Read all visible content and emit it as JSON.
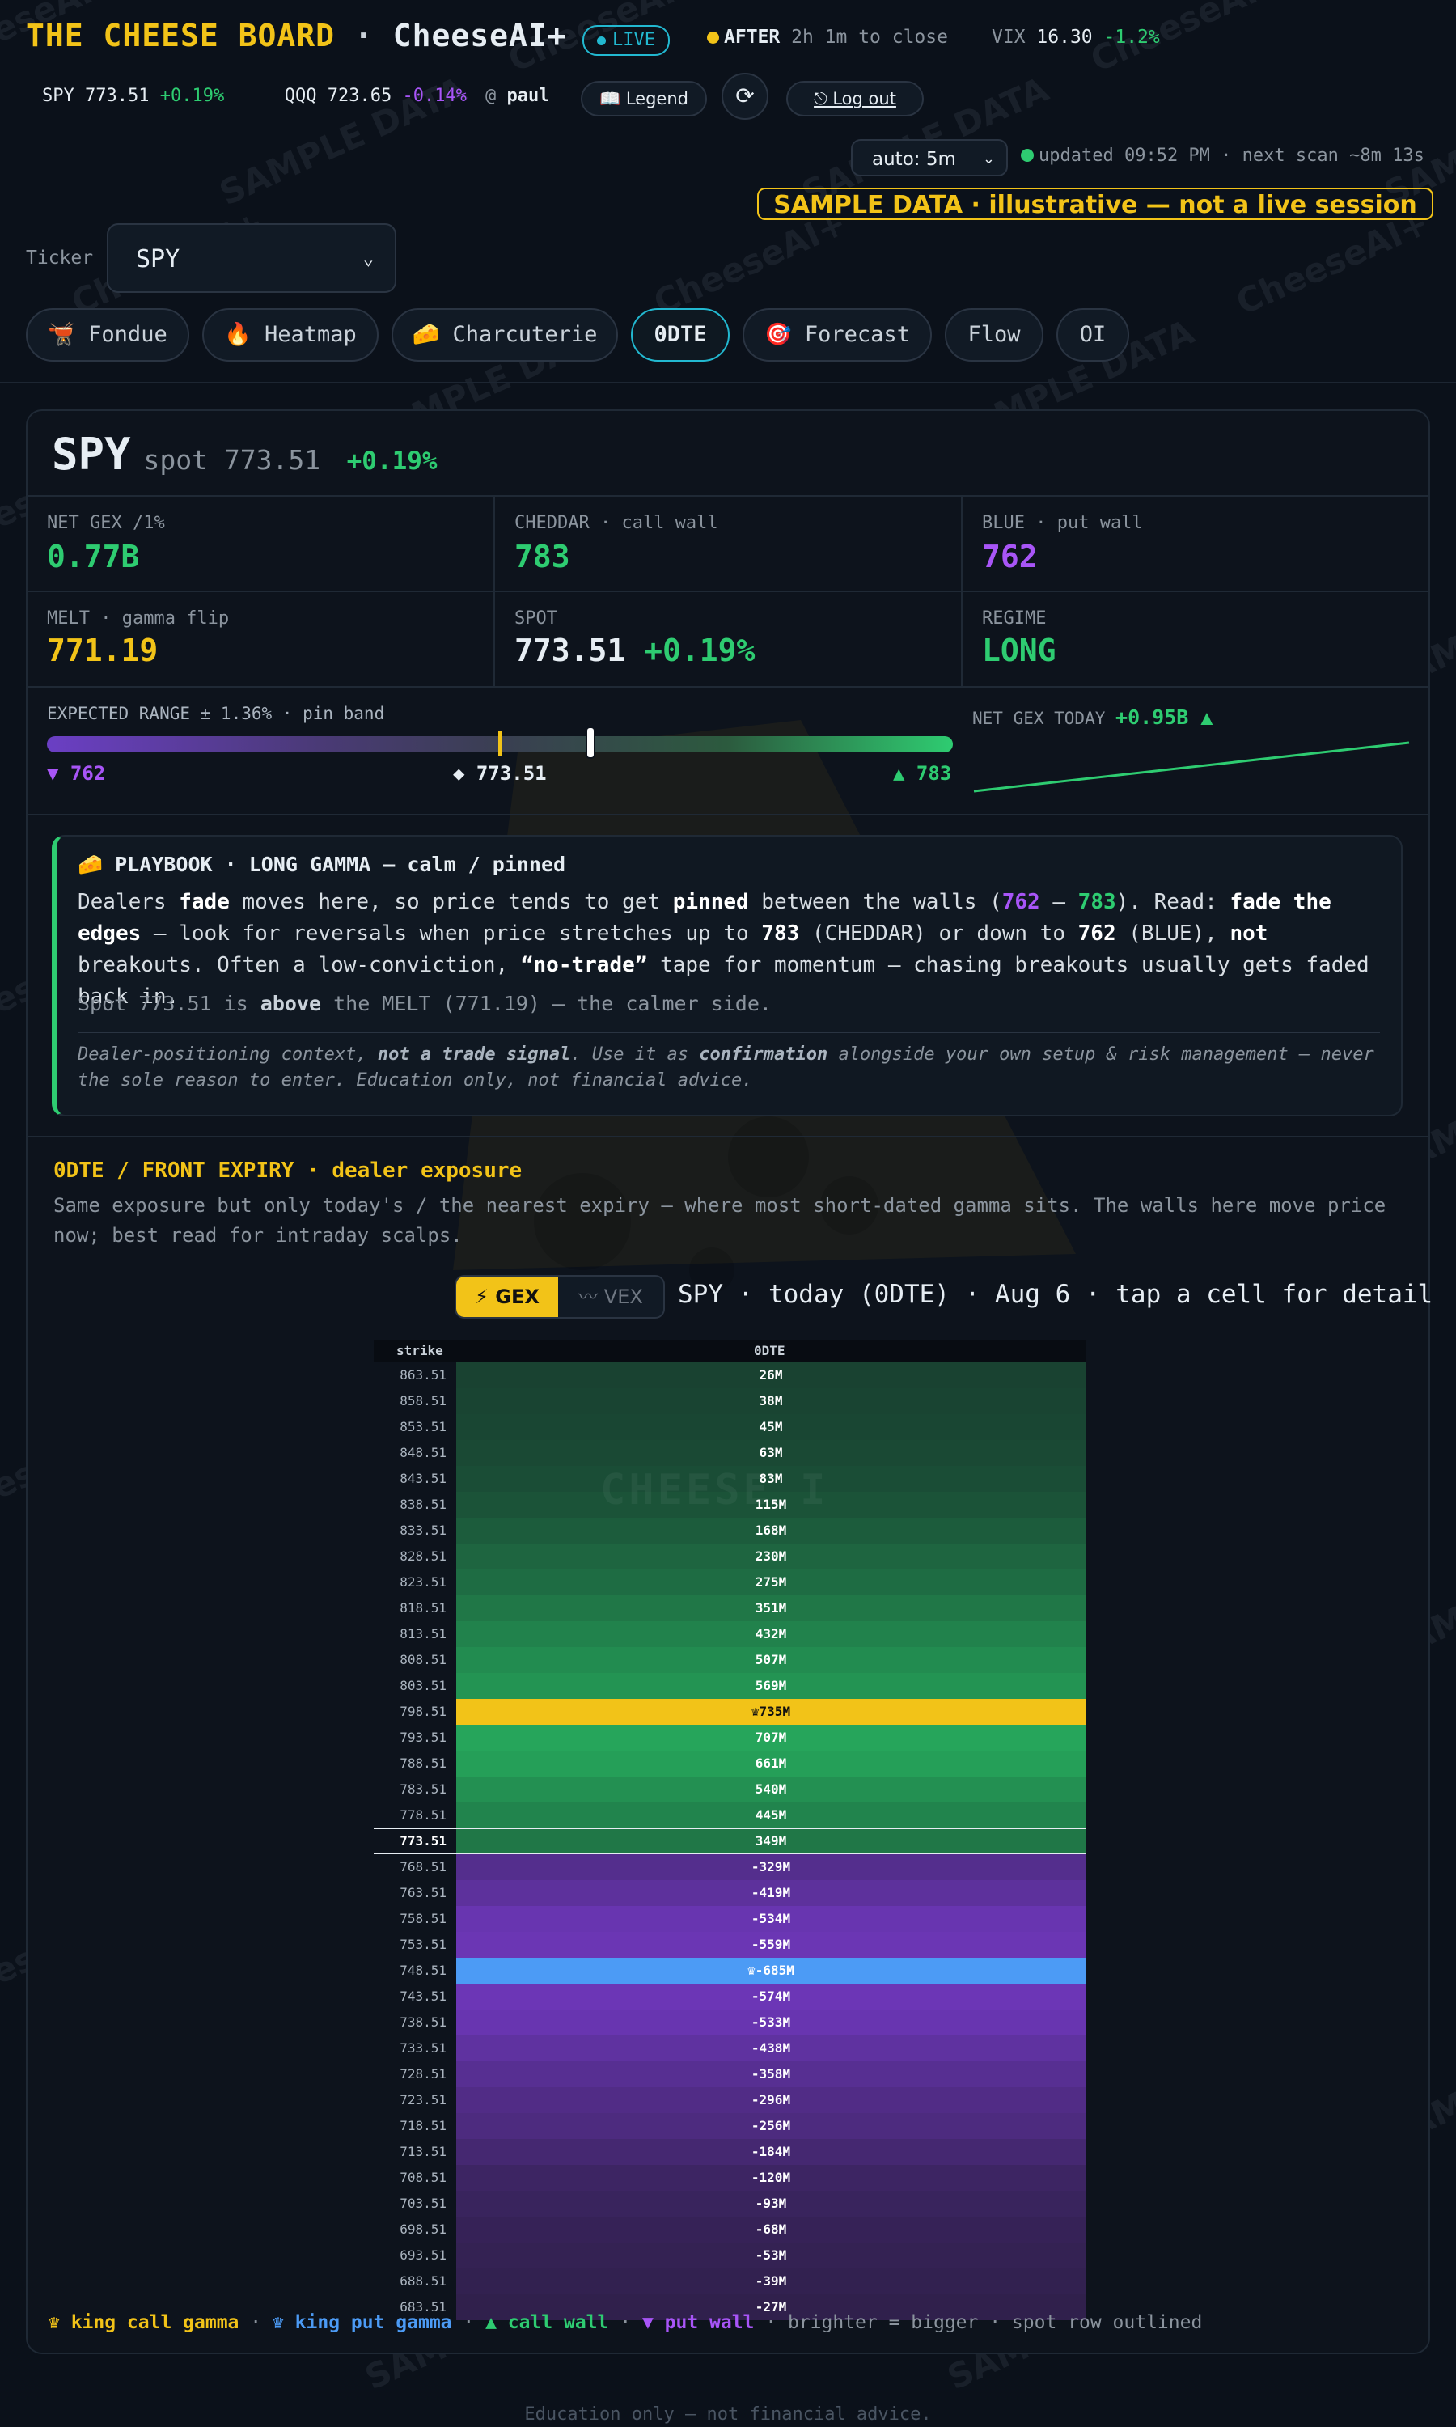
{
  "header": {
    "brand": "THE CHEESE BOARD",
    "brand_sep": " · ",
    "brand_ai": "CheeseAI+",
    "live": "LIVE",
    "session_state": "AFTER",
    "session_time": "2h 1m to close",
    "vix_label": "VIX",
    "vix_value": "16.30",
    "vix_change": "-1.2%"
  },
  "quotes": [
    {
      "symbol": "SPY",
      "price": "773.51",
      "change": "+0.19%",
      "color": "#2ecc71"
    },
    {
      "symbol": "QQQ",
      "price": "723.65",
      "change": "-0.14%",
      "color": "#a855f7"
    }
  ],
  "user": {
    "prefix": "@",
    "name": "paul"
  },
  "buttons": {
    "legend": "📖 Legend",
    "refresh": "⟳",
    "logout": "⎋ Log out"
  },
  "auto_refresh": {
    "value": "auto: 5m"
  },
  "updated_text": "updated 09:52 PM · next scan ~8m 13s",
  "sample_banner": "SAMPLE DATA · illustrative — not a live session",
  "ticker": {
    "label": "Ticker",
    "value": "SPY"
  },
  "tabs": [
    {
      "label": "🫕 Fondue"
    },
    {
      "label": "🔥 Heatmap"
    },
    {
      "label": "🧀 Charcuterie"
    },
    {
      "label": "0DTE",
      "active": true
    },
    {
      "label": "🎯 Forecast"
    },
    {
      "label": "Flow"
    },
    {
      "label": "OI"
    }
  ],
  "summary": {
    "symbol": "SPY",
    "spot_label": "spot 773.51",
    "spot_change": "+0.19%"
  },
  "stats": [
    {
      "label": "NET GEX /1%",
      "value": "0.77B",
      "color": "#2ecc71"
    },
    {
      "label": "CHEDDAR · call wall",
      "value": "783",
      "color": "#2ecc71"
    },
    {
      "label": "BLUE · put wall",
      "value": "762",
      "color": "#a855f7"
    },
    {
      "label": "MELT · gamma flip",
      "value": "771.19",
      "color": "#f2c318"
    },
    {
      "label": "SPOT",
      "value": "773.51",
      "change": "+0.19%",
      "color": "#e6edf3"
    },
    {
      "label": "REGIME",
      "value": "LONG",
      "color": "#2ecc71"
    }
  ],
  "expected_range": {
    "label": "EXPECTED RANGE ± 1.36% · pin band",
    "low": "▼ 762",
    "spot": "◆ 773.51",
    "high": "▲ 783",
    "low_value": 762,
    "high_value": 783,
    "melt_value": 771.19,
    "spot_value": 773.51
  },
  "net_gex_today": {
    "label": "NET GEX TODAY",
    "value": "+0.95B ▲",
    "trend_start": 0.0,
    "trend_end": 1.0
  },
  "playbook": {
    "title": "🧀 PLAYBOOK · LONG GAMMA — calm / pinned",
    "spot_line_1": "Spot 773.51 is ",
    "spot_line_bold": "above",
    "spot_line_2": " the MELT (771.19) — the calmer side."
  },
  "dte": {
    "title": "0DTE / FRONT EXPIRY · dealer exposure",
    "description": "Same exposure but only today's / the nearest expiry — where most short-dated gamma sits. The walls here move price now; best read for intraday scalps.",
    "toggle_gex": "⚡ GEX",
    "toggle_vex": "〰 VEX",
    "caption": "SPY · today (0DTE) · Aug 6 · tap a cell for detail",
    "col_strike": "strike",
    "col_expiry": "0DTE",
    "watermark": "CHEESE I"
  },
  "heatmap_rows": [
    {
      "strike": "863.51",
      "value": 26,
      "label": "26M"
    },
    {
      "strike": "858.51",
      "value": 38,
      "label": "38M"
    },
    {
      "strike": "853.51",
      "value": 45,
      "label": "45M"
    },
    {
      "strike": "848.51",
      "value": 63,
      "label": "63M"
    },
    {
      "strike": "843.51",
      "value": 83,
      "label": "83M"
    },
    {
      "strike": "838.51",
      "value": 115,
      "label": "115M"
    },
    {
      "strike": "833.51",
      "value": 168,
      "label": "168M"
    },
    {
      "strike": "828.51",
      "value": 230,
      "label": "230M"
    },
    {
      "strike": "823.51",
      "value": 275,
      "label": "275M"
    },
    {
      "strike": "818.51",
      "value": 351,
      "label": "351M"
    },
    {
      "strike": "813.51",
      "value": 432,
      "label": "432M"
    },
    {
      "strike": "808.51",
      "value": 507,
      "label": "507M"
    },
    {
      "strike": "803.51",
      "value": 569,
      "label": "569M"
    },
    {
      "strike": "798.51",
      "value": 735,
      "label": "♛735M",
      "king": "call"
    },
    {
      "strike": "793.51",
      "value": 707,
      "label": "707M"
    },
    {
      "strike": "788.51",
      "value": 661,
      "label": "661M"
    },
    {
      "strike": "783.51",
      "value": 540,
      "label": "540M"
    },
    {
      "strike": "778.51",
      "value": 445,
      "label": "445M"
    },
    {
      "strike": "773.51",
      "value": 349,
      "label": "349M",
      "spot": true
    },
    {
      "strike": "768.51",
      "value": -329,
      "label": "-329M"
    },
    {
      "strike": "763.51",
      "value": -419,
      "label": "-419M"
    },
    {
      "strike": "758.51",
      "value": -534,
      "label": "-534M"
    },
    {
      "strike": "753.51",
      "value": -559,
      "label": "-559M"
    },
    {
      "strike": "748.51",
      "value": -685,
      "label": "♛-685M",
      "king": "put"
    },
    {
      "strike": "743.51",
      "value": -574,
      "label": "-574M"
    },
    {
      "strike": "738.51",
      "value": -533,
      "label": "-533M"
    },
    {
      "strike": "733.51",
      "value": -438,
      "label": "-438M"
    },
    {
      "strike": "728.51",
      "value": -358,
      "label": "-358M"
    },
    {
      "strike": "723.51",
      "value": -296,
      "label": "-296M"
    },
    {
      "strike": "718.51",
      "value": -256,
      "label": "-256M"
    },
    {
      "strike": "713.51",
      "value": -184,
      "label": "-184M"
    },
    {
      "strike": "708.51",
      "value": -120,
      "label": "-120M"
    },
    {
      "strike": "703.51",
      "value": -93,
      "label": "-93M"
    },
    {
      "strike": "698.51",
      "value": -68,
      "label": "-68M"
    },
    {
      "strike": "693.51",
      "value": -53,
      "label": "-53M"
    },
    {
      "strike": "688.51",
      "value": -39,
      "label": "-39M"
    },
    {
      "strike": "683.51",
      "value": -27,
      "label": "-27M"
    }
  ],
  "legend": {
    "king_call": "♛ king call gamma",
    "king_put": "♛ king put gamma",
    "call_wall": "▲ call wall",
    "put_wall": "▼ put wall",
    "rest": "brighter = bigger · spot row outlined"
  },
  "footer": "Education only — not financial advice.",
  "watermarks": [
    "CheeseAI+",
    "SAMPLE DATA"
  ],
  "colors": {
    "accent": "#f2c318",
    "call": "#2ecc71",
    "put": "#a855f7",
    "king_put": "#4c9bf5",
    "live": "#22b8d0"
  }
}
